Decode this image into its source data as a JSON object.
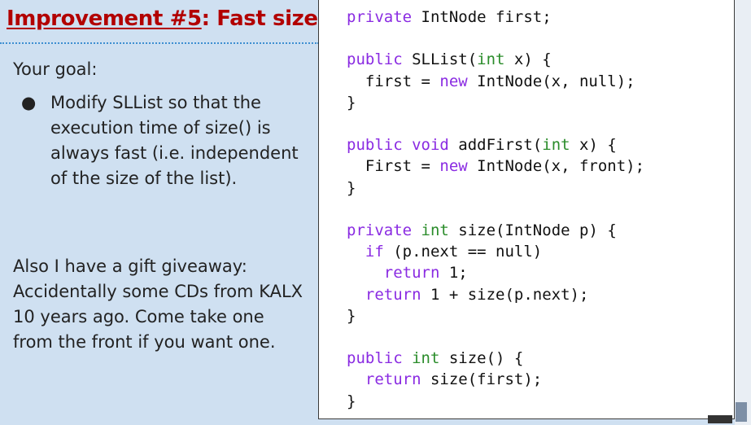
{
  "title": {
    "prefix": "Improvement ",
    "number": "#5",
    "suffix": ": Fast size()"
  },
  "goal": {
    "heading": "Your goal:",
    "bullet_symbol": "●",
    "bullet_text": "Modify SLList so that the execution time of size() is always fast (i.e. independent of the size of the list)."
  },
  "gift_text": "Also I have a gift giveaway: Accidentally some CDs from KALX 10 years ago. Come take one from the front if you want one.",
  "code": {
    "lines": [
      "private IntNode first;",
      "",
      "public SLList(int x) {",
      "  first = new IntNode(x, null);",
      "}",
      "",
      "public void addFirst(int x) {",
      "  First = new IntNode(x, front);",
      "}",
      "",
      "private int size(IntNode p) {",
      "  if (p.next == null)",
      "    return 1;",
      "  return 1 + size(p.next);",
      "}",
      "",
      "public int size() {",
      "  return size(first);",
      "}"
    ]
  },
  "colors": {
    "background": "#cfe0f1",
    "title": "#b20000",
    "keyword": "#8a2be2",
    "type": "#2a8c2a"
  }
}
